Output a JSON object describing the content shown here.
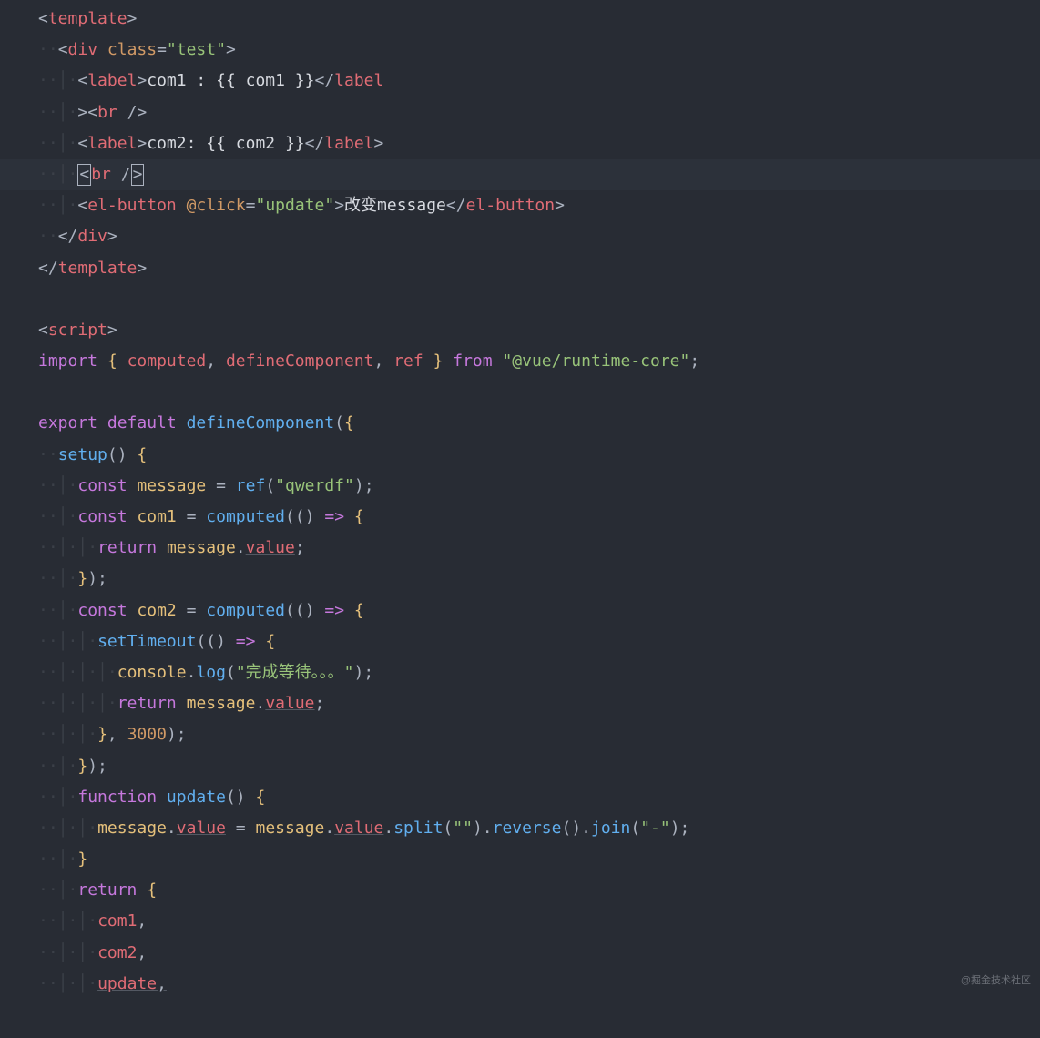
{
  "watermark": "@掘金技术社区",
  "code": {
    "template_open": "template",
    "div": "div",
    "class_attr": "class",
    "class_val": "\"test\"",
    "label": "label",
    "com1_text": "com1 : {{ com1 }}",
    "br": "br",
    "com2_text": "com2: {{ com2 }}",
    "elbutton": "el-button",
    "click_attr": "@click",
    "click_val": "\"update\"",
    "btn_text": "改变message",
    "template_close": "template",
    "script_tag": "script",
    "import": "import",
    "computed": "computed",
    "defineComponent": "defineComponent",
    "ref": "ref",
    "from": "from",
    "vue_path": "\"@vue/runtime-core\"",
    "export": "export",
    "default": "default",
    "setup": "setup",
    "const": "const",
    "message": "message",
    "qwerdf": "\"qwerdf\"",
    "com1": "com1",
    "com2": "com2",
    "return": "return",
    "value": "value",
    "setTimeout": "setTimeout",
    "console": "console",
    "log": "log",
    "wait_msg": "\"完成等待。。。\"",
    "three_thousand": "3000",
    "function": "function",
    "update": "update",
    "split": "split",
    "reverse": "reverse",
    "join": "join",
    "empty_str": "\"\"",
    "dash_str": "\"-\""
  }
}
